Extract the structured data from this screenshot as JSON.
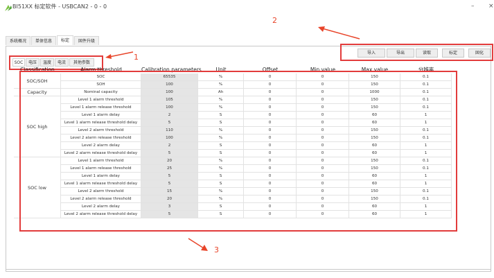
{
  "window": {
    "title": "BI51XX 标定软件 - USBCAN2 - 0 - 0",
    "minimize": "–",
    "close": "×"
  },
  "annotations": {
    "n1": "1",
    "n2": "2",
    "n3": "3",
    "color": "#e8452a"
  },
  "main_tabs": [
    "系统概况",
    "单体信息",
    "标定",
    "固件升级"
  ],
  "sub_tabs": [
    "SOC",
    "电压",
    "温度",
    "电流",
    "其他参数"
  ],
  "toolbar": [
    "导入",
    "导出",
    "读取",
    "标定",
    "固化"
  ],
  "table": {
    "headers": [
      "Classification",
      "Alarm threshold",
      "Calibration parameters",
      "Unit",
      "Offset",
      "Min.value",
      "Max.value",
      "分辨率"
    ],
    "groups": [
      {
        "label": "SOC/SOH",
        "rows": [
          [
            "SOC",
            "65535",
            "%",
            "0",
            "0",
            "150",
            "0.1"
          ],
          [
            "SOH",
            "100",
            "%",
            "0",
            "0",
            "150",
            "0.1"
          ]
        ]
      },
      {
        "label": "Capacity",
        "rows": [
          [
            "Nominal capacity",
            "100",
            "Ah",
            "0",
            "0",
            "1000",
            "0.1"
          ]
        ]
      },
      {
        "label": "SOC high",
        "rows": [
          [
            "Level 1 alarm threshold",
            "105",
            "%",
            "0",
            "0",
            "150",
            "0.1"
          ],
          [
            "Level 1 alarm release threshold",
            "100",
            "%",
            "0",
            "0",
            "150",
            "0.1"
          ],
          [
            "Level 1 alarm delay",
            "2",
            "S",
            "0",
            "0",
            "60",
            "1"
          ],
          [
            "Level 1 alarm release threshold delay",
            "5",
            "S",
            "0",
            "0",
            "60",
            "1"
          ],
          [
            "Level 2 alarm threshold",
            "110",
            "%",
            "0",
            "0",
            "150",
            "0.1"
          ],
          [
            "Level 2 alarm release threshold",
            "100",
            "%",
            "0",
            "0",
            "150",
            "0.1"
          ],
          [
            "Level 2 alarm delay",
            "2",
            "S",
            "0",
            "0",
            "60",
            "1"
          ],
          [
            "Level 2 alarm release threshold delay",
            "5",
            "S",
            "0",
            "0",
            "60",
            "1"
          ]
        ]
      },
      {
        "label": "SOC low",
        "rows": [
          [
            "Level 1 alarm threshold",
            "20",
            "%",
            "0",
            "0",
            "150",
            "0.1"
          ],
          [
            "Level 1 alarm release threshold",
            "25",
            "%",
            "0",
            "0",
            "150",
            "0.1"
          ],
          [
            "Level 1 alarm delay",
            "5",
            "S",
            "0",
            "0",
            "60",
            "1"
          ],
          [
            "Level 1 alarm release threshold delay",
            "5",
            "S",
            "0",
            "0",
            "60",
            "1"
          ],
          [
            "Level 2 alarm threshold",
            "15",
            "%",
            "0",
            "0",
            "150",
            "0.1"
          ],
          [
            "Level 2 alarm release threshold",
            "20",
            "%",
            "0",
            "0",
            "150",
            "0.1"
          ],
          [
            "Level 2 alarm delay",
            "3",
            "S",
            "0",
            "0",
            "60",
            "1"
          ],
          [
            "Level 2 alarm release threshold delay",
            "5",
            "S",
            "0",
            "0",
            "60",
            "1"
          ]
        ]
      }
    ]
  }
}
